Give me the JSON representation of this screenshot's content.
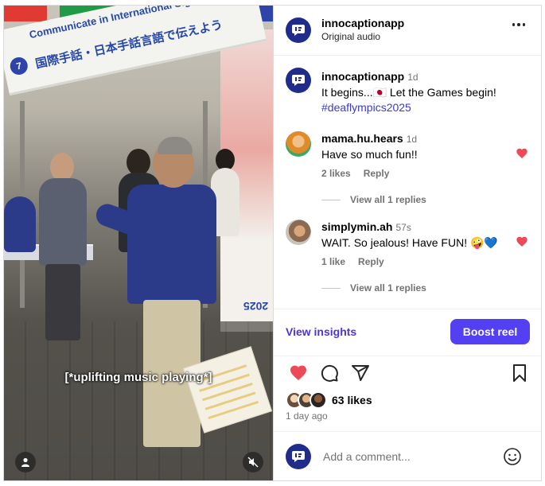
{
  "video": {
    "banner_text_1": "Communicate in International Sign and Japanese Sign Language!",
    "banner_text_2": "国際手話・日本手話言語で伝えよう",
    "banner_badge": "7",
    "sign_text": "2025",
    "caption": "[*uplifting music playing*]",
    "user_button_icon": "person-icon",
    "audio_button_icon": "muted-speaker-icon"
  },
  "header": {
    "username": "innocaptionapp",
    "subtitle": "Original audio",
    "more_icon": "more-horizontal-icon"
  },
  "comments": [
    {
      "username": "innocaptionapp",
      "time": "1d",
      "text": "It begins...🇯🇵 Let the Games begin!",
      "hashtag": "#deaflympics2025"
    },
    {
      "username": "mama.hu.hears",
      "time": "1d",
      "text": "Have so much fun!!",
      "likes": "2 likes",
      "reply": "Reply",
      "view_replies": "View all 1 replies"
    },
    {
      "username": "simplymin.ah",
      "time": "57s",
      "text": "WAIT. So jealous! Have FUN! 🤪💙",
      "likes": "1 like",
      "reply": "Reply",
      "view_replies": "View all 1 replies"
    }
  ],
  "insights": {
    "view_label": "View insights",
    "boost_label": "Boost reel"
  },
  "engagement": {
    "likes": "63 likes",
    "posted": "1 day ago"
  },
  "comment_input": {
    "placeholder": "Add a comment..."
  },
  "colors": {
    "brand": "#1f2c8c",
    "accent": "#5340f2",
    "link": "#4c35d9",
    "heart": "#ed4956"
  }
}
